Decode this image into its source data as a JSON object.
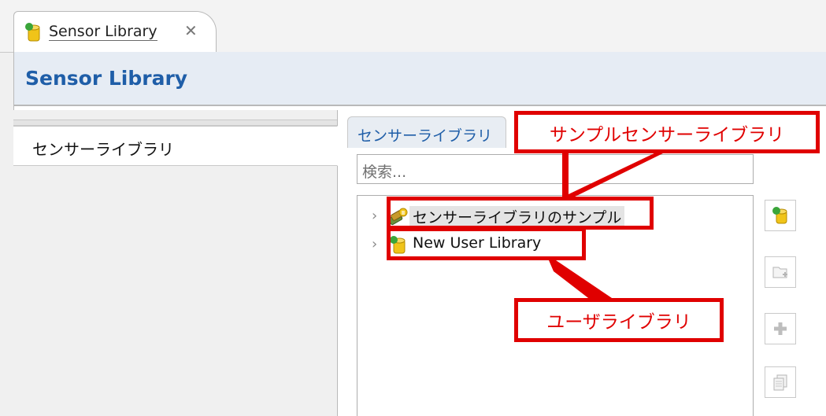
{
  "editor_tab": {
    "label": "Sensor Library",
    "close_glyph": "✕"
  },
  "header": {
    "title": "Sensor Library"
  },
  "left_panel": {
    "tab_label": "センサーライブラリ"
  },
  "right_panel": {
    "section_label": "センサーライブラリ",
    "search_placeholder": "検索...",
    "tree_items": [
      {
        "label": "センサーライブラリのサンプル",
        "icon": "sample-library-icon",
        "expander": "›"
      },
      {
        "label": "New User Library",
        "icon": "user-library-icon",
        "expander": "›"
      }
    ],
    "toolbar": [
      {
        "icon": "add-library-icon",
        "enabled": true
      },
      {
        "icon": "add-folder-icon",
        "enabled": false
      },
      {
        "icon": "add-sensor-icon",
        "enabled": false
      },
      {
        "icon": "copy-icon",
        "enabled": false
      }
    ]
  },
  "annotations": {
    "sample_library": "サンプルセンサーライブラリ",
    "user_library": "ユーザライブラリ"
  },
  "colors": {
    "annotation_red": "#e00000",
    "header_blue": "#1f5ea8",
    "library_green": "#3aa53a",
    "library_yellow": "#f0c419"
  }
}
